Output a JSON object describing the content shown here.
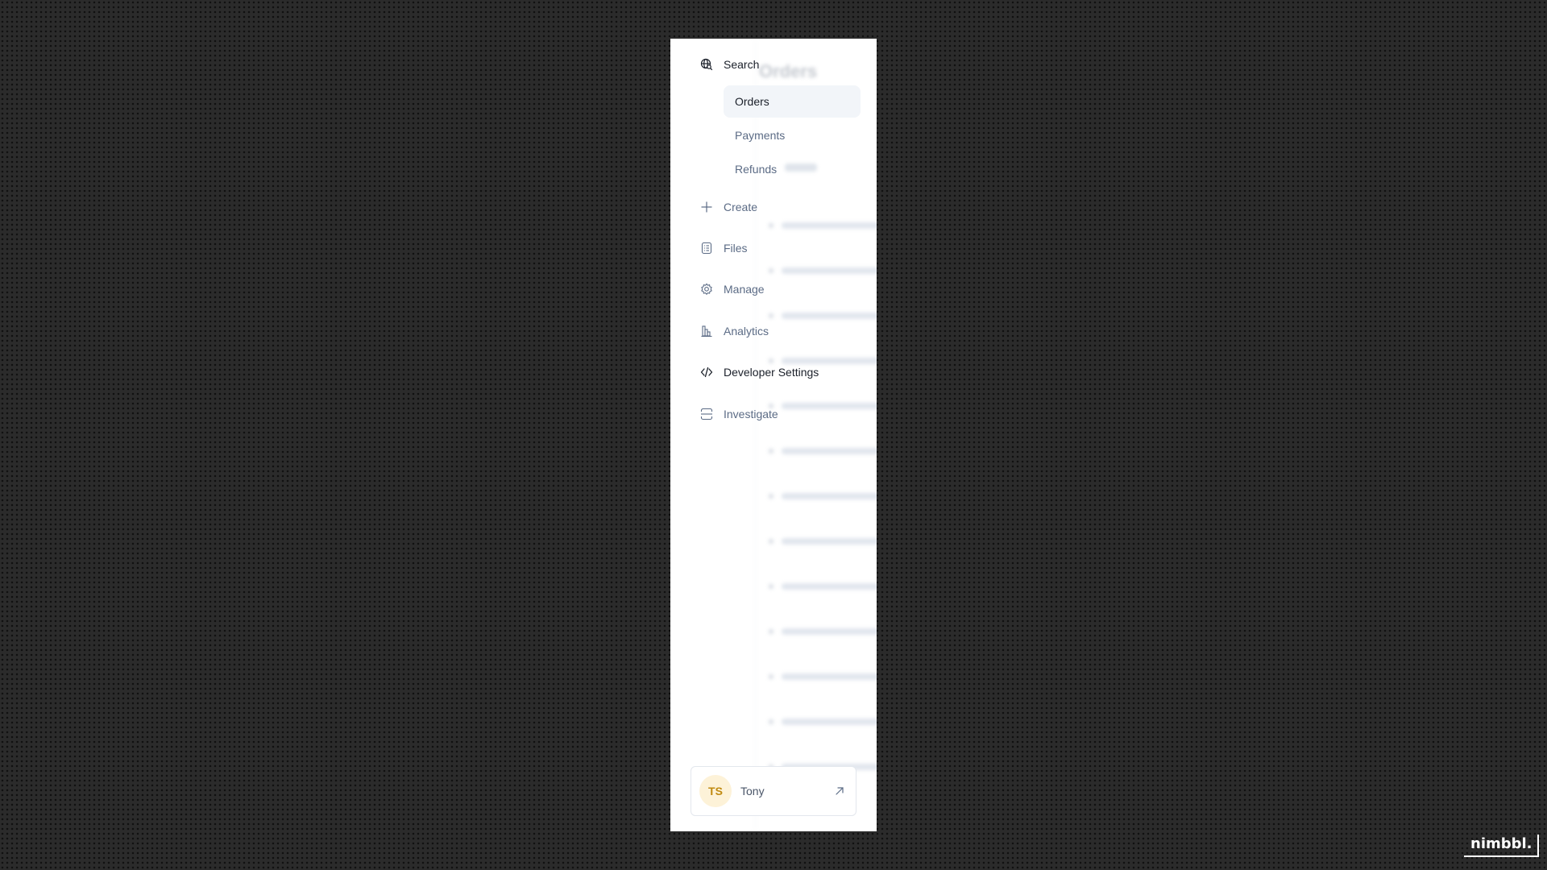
{
  "background_content": {
    "title": "Orders"
  },
  "sidebar": {
    "search": {
      "label": "Search",
      "icon": "search-globe-icon"
    },
    "search_subitems": [
      {
        "label": "Orders",
        "selected": true
      },
      {
        "label": "Payments",
        "selected": false
      },
      {
        "label": "Refunds",
        "selected": false
      }
    ],
    "items": [
      {
        "label": "Create",
        "icon": "plus-icon"
      },
      {
        "label": "Files",
        "icon": "file-icon"
      },
      {
        "label": "Manage",
        "icon": "gear-icon"
      },
      {
        "label": "Analytics",
        "icon": "bar-chart-icon"
      },
      {
        "label": "Developer Settings",
        "icon": "code-icon"
      },
      {
        "label": "Investigate",
        "icon": "scan-icon"
      }
    ]
  },
  "user": {
    "initials": "TS",
    "name": "Tony",
    "avatar_bg": "#fdf2d8",
    "avatar_fg": "#c08a10"
  },
  "brand": {
    "logo_text": "nimbbl."
  },
  "colors": {
    "text_active": "#1a1f29",
    "text_muted": "#5b6b85",
    "selected_bg": "#f2f5f9"
  }
}
